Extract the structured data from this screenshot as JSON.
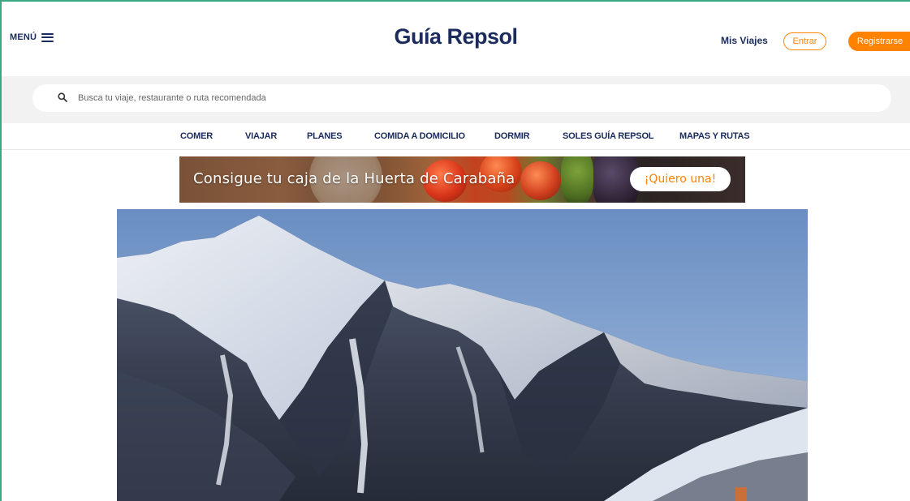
{
  "header": {
    "menu_label": "MENÚ",
    "logo": "Guía Repsol",
    "mis_viajes": "Mis Viajes",
    "entrar": "Entrar",
    "registrarse": "Registrarse"
  },
  "search": {
    "placeholder": "Busca tu viaje, restaurante o ruta recomendada",
    "value": ""
  },
  "nav": {
    "items": [
      "COMER",
      "VIAJAR",
      "PLANES",
      "COMIDA A DOMICILIO",
      "DORMIR",
      "SOLES GUÍA REPSOL",
      "MAPAS Y RUTAS"
    ]
  },
  "ad": {
    "text": "Consigue tu caja de la Huerta de Carabaña",
    "cta": "¡Quiero una!"
  },
  "colors": {
    "brand_navy": "#1a2b5c",
    "accent_orange": "#ff8200",
    "search_band": "#f2f2f2"
  },
  "icons": [
    "menu-icon",
    "search-icon"
  ]
}
